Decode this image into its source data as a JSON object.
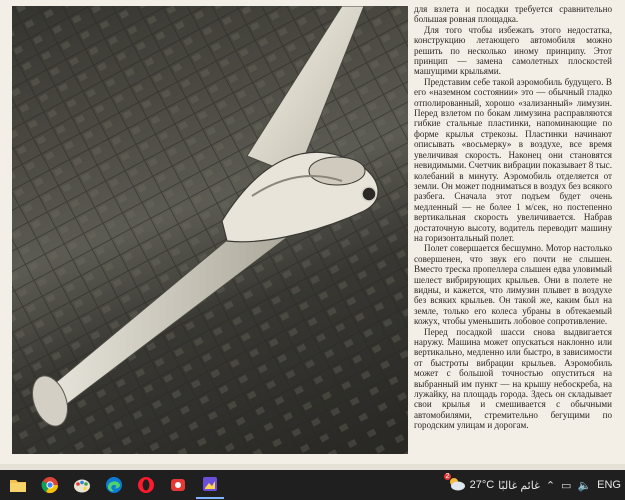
{
  "article": {
    "paragraphs": [
      "для взлета и посадки требуется сравнительно большая ровная площадка.",
      "Для того чтобы избежать этого недостатка, конструкцию летающего автомобиля можно решить по несколько иному принципу. Этот принцип — замена самолетных плоскостей машущими крыльями.",
      "Представим себе такой аэромобиль будущего. В его «наземном состоянии» это — обычный гладко отполированный, хорошо «зализанный» лимузин. Перед взлетом по бокам лимузина расправляются гибкие стальные пластинки, напоминающие по форме крылья стрекозы. Пластинки начинают описывать «восьмерку» в воздухе, все время увеличивая скорость. Наконец они становятся невидимыми. Счетчик вибрации показывает 8 тыс. колебаний в минуту. Аэромобиль отделяется от земли. Он может подниматься в воздух без всякого разбега. Сначала этот подъем будет очень медленный — не более 1 м/сек, но постепенно вертикальная скорость увеличивается. Набрав достаточную высоту, водитель переводит машину на горизонтальный полет.",
      "Полет совершается бесшумно. Мотор настолько совершенен, что звук его почти не слышен. Вместо треска пропеллера слышен едва уловимый шелест вибрирующих крыльев. Они в полете не видны, и кажется, что лимузин плывет в воздухе без всяких крыльев. Он такой же, каким был на земле, только его колеса убраны в обтекаемый кожух, чтобы уменьшить лобовое сопротивление.",
      "Перед посадкой шасси снова выдвигается наружу. Машина может опускаться наклонно или вертикально, медленно или быстро, в зависимости от быстроты вибрации крыльев. Аэромобиль может с большой точностью опуститься на выбранный им пункт — на крышу небоскреба, на лужайку, на площадь города. Здесь он складывает свои крылья и смешивается с обычными автомобилями, стремительно бегущими по городским улицам и дорогам."
    ]
  },
  "taskbar": {
    "apps": [
      {
        "name": "file-explorer-icon",
        "color": "#f2c14e"
      },
      {
        "name": "chrome-icon",
        "color": "#4285f4"
      },
      {
        "name": "paint-icon",
        "color": "#8bc34a"
      },
      {
        "name": "edge-icon",
        "color": "#1da1f2"
      },
      {
        "name": "opera-icon",
        "color": "#ff1b2d"
      },
      {
        "name": "app-red-icon",
        "color": "#e53935"
      },
      {
        "name": "viewer-app-icon",
        "color": "#6b4fd8"
      }
    ],
    "weather_temp": "27°C",
    "weather_text": "غائم غالبًا",
    "weather_badge": "2",
    "language": "ENG"
  }
}
